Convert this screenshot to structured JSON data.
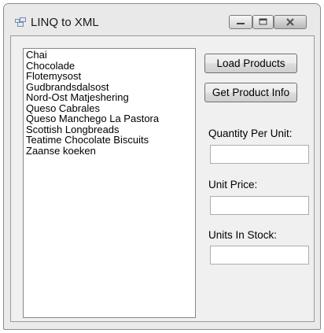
{
  "window": {
    "title": "LINQ to XML",
    "icon": "windows-form-icon"
  },
  "products": [
    "Chai",
    "Chocolade",
    "Flotemysost",
    "Gudbrandsdalsost",
    "Nord-Ost Matjeshering",
    "Queso Cabrales",
    "Queso Manchego La Pastora",
    "Scottish Longbreads",
    "Teatime Chocolate Biscuits",
    "Zaanse koeken"
  ],
  "buttons": {
    "load": "Load Products",
    "info": "Get Product Info"
  },
  "fields": {
    "quantity_label": "Quantity Per Unit:",
    "quantity_value": "",
    "price_label": "Unit Price:",
    "price_value": "",
    "stock_label": "Units In Stock:",
    "stock_value": ""
  }
}
